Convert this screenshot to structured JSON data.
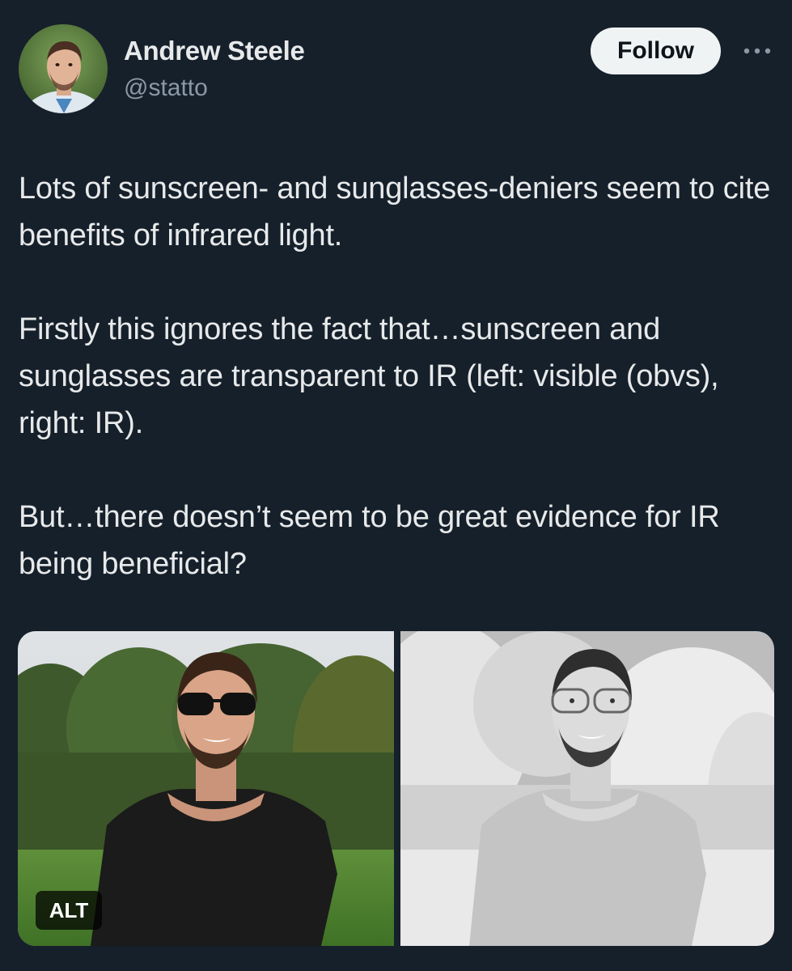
{
  "author": {
    "name": "Andrew Steele",
    "handle": "@statto"
  },
  "actions": {
    "follow_label": "Follow",
    "more_icon": "more-horizontal-icon"
  },
  "tweet": {
    "paragraphs": [
      "Lots of sunscreen- and sunglasses-deniers seem to cite benefits of infrared light.",
      "Firstly this ignores the fact that…sunscreen and sunglasses are transparent to IR (left: visible (obvs), right: IR).",
      "But…there doesn’t seem to be great evidence for IR being beneficial?"
    ]
  },
  "media": {
    "alt_label": "ALT",
    "images": [
      {
        "description_icon": "photo-visible-light",
        "mode": "color"
      },
      {
        "description_icon": "photo-infrared",
        "mode": "grayscale"
      }
    ]
  },
  "colors": {
    "background": "#16202b",
    "text_primary": "#e7e9ea",
    "text_secondary": "#8b98a5",
    "follow_bg": "#eff3f4",
    "follow_text": "#0f1419"
  }
}
